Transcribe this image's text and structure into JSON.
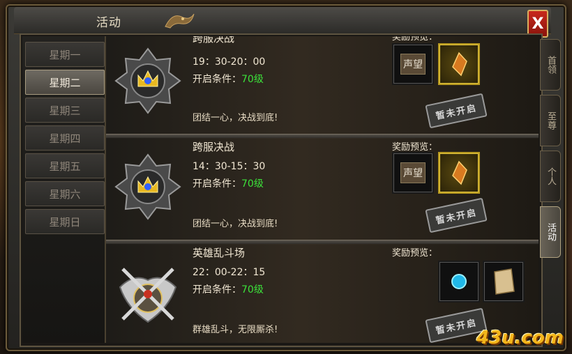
{
  "window": {
    "title": "活动",
    "close_label": "X"
  },
  "days": [
    {
      "label": "星期一",
      "active": false
    },
    {
      "label": "星期二",
      "active": true
    },
    {
      "label": "星期三",
      "active": false
    },
    {
      "label": "星期四",
      "active": false
    },
    {
      "label": "星期五",
      "active": false
    },
    {
      "label": "星期六",
      "active": false
    },
    {
      "label": "星期日",
      "active": false
    }
  ],
  "events": [
    {
      "name": "跨服决战",
      "time": "19：30-20：00",
      "condition_prefix": "开启条件：",
      "level": "70级",
      "desc": "团结一心，决战到底!",
      "reward_label": "奖励预览：",
      "rewards": [
        "prestige-scroll-icon",
        "gold-shard-icon"
      ],
      "reward_texts": [
        "声望",
        ""
      ],
      "stamp": "暂未开启"
    },
    {
      "name": "跨服决战",
      "time": "14：30-15：30",
      "condition_prefix": "开启条件：",
      "level": "70级",
      "desc": "团结一心，决战到底!",
      "reward_label": "奖励预览：",
      "rewards": [
        "prestige-scroll-icon",
        "gold-shard-icon"
      ],
      "reward_texts": [
        "声望",
        ""
      ],
      "stamp": "暂未开启"
    },
    {
      "name": "英雄乱斗场",
      "time": "22：00-22：15",
      "condition_prefix": "开启条件：",
      "level": "70级",
      "desc": "群雄乱斗，无限厮杀!",
      "reward_label": "奖励预览：",
      "rewards": [
        "blue-orb-icon",
        "parchment-scroll-icon"
      ],
      "reward_texts": [
        "",
        ""
      ],
      "stamp": "暂未开启"
    }
  ],
  "side_tabs": [
    {
      "label": "首领",
      "active": false
    },
    {
      "label": "至尊",
      "active": false
    },
    {
      "label": "个人",
      "active": false
    },
    {
      "label": "活动",
      "active": true
    }
  ],
  "watermark": "43u.com",
  "colors": {
    "level_green": "#3ce03a",
    "close_red": "#c8281c",
    "watermark_gold": "#f3b51a"
  }
}
